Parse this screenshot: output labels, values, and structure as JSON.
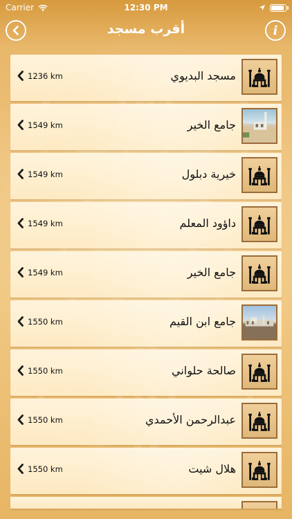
{
  "status_bar": {
    "carrier": "Carrier",
    "time": "12:30 PM",
    "wifi_icon": "wifi-icon",
    "location_icon": "location-arrow-icon",
    "battery_icon": "battery-icon"
  },
  "nav": {
    "title": "أقرب مسجد",
    "back_icon": "chevron-left-icon",
    "info_icon": "info-icon"
  },
  "mosques": [
    {
      "name": "مسجد البديوي",
      "distance": "1236 km",
      "thumb_type": "icon"
    },
    {
      "name": "جامع الخير",
      "distance": "1549 km",
      "thumb_type": "photo1"
    },
    {
      "name": "خيرية دبلول",
      "distance": "1549 km",
      "thumb_type": "icon"
    },
    {
      "name": "داؤود المعلم",
      "distance": "1549 km",
      "thumb_type": "icon"
    },
    {
      "name": "جامع الخير",
      "distance": "1549 km",
      "thumb_type": "icon"
    },
    {
      "name": "جامع ابن القيم",
      "distance": "1550 km",
      "thumb_type": "photo2"
    },
    {
      "name": "صالحة حلواني",
      "distance": "1550 km",
      "thumb_type": "icon"
    },
    {
      "name": "عبدالرحمن الأحمدي",
      "distance": "1550 km",
      "thumb_type": "icon"
    },
    {
      "name": "هلال شيت",
      "distance": "1550 km",
      "thumb_type": "icon"
    }
  ],
  "colors": {
    "accent": "#d79a3e",
    "card_bg": "#fff1d8",
    "thumb_border": "#9a6b3b"
  }
}
